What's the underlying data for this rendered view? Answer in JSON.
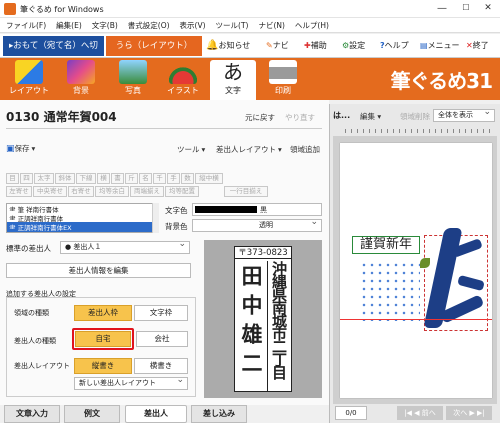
{
  "window": {
    "title": "筆ぐるめ for Windows",
    "min": "—",
    "max": "☐",
    "close": "✕"
  },
  "menu": [
    "ファイル(F)",
    "編集(E)",
    "文字(B)",
    "書式設定(O)",
    "表示(V)",
    "ツール(T)",
    "ナビ(N)",
    "ヘルプ(H)"
  ],
  "modes": {
    "front": "▸おもて（宛て名）へ切替",
    "back": "うら（レイアウト）"
  },
  "top_tools": [
    {
      "label": "お知らせ",
      "icon": "bell-icon"
    },
    {
      "label": "ナビ",
      "icon": "pen-icon"
    },
    {
      "label": "補助",
      "icon": "puzzle-icon"
    },
    {
      "label": "設定",
      "icon": "gear-icon"
    },
    {
      "label": "ヘルプ",
      "icon": "question-icon"
    },
    {
      "label": "メニュー",
      "icon": "menu-icon"
    },
    {
      "label": "終了",
      "icon": "close-icon"
    }
  ],
  "ribbon": {
    "items": [
      "レイアウト",
      "背景",
      "写真",
      "イラスト",
      "文字",
      "印刷"
    ],
    "selected": "文字",
    "brand": "筆ぐるめ31",
    "accent": "#e46b1e"
  },
  "doc": {
    "title": "0130 通常年賀004",
    "undo": "元に戻す",
    "redo": "やり直す"
  },
  "toolbar": {
    "save": "保存",
    "save_arrow": "▾",
    "tools": "ツール",
    "tools_arrow": "▾",
    "sender_layout": "差出人レイアウト",
    "sender_layout_arrow": "▾",
    "add_area": "領域追加"
  },
  "format_row1": [
    "目",
    "四",
    "太字",
    "斜体",
    "下線",
    "横",
    "書",
    "斤",
    "名",
    "千",
    "手",
    "数",
    "縦中横"
  ],
  "format_row2": [
    "左寄せ",
    "中央寄せ",
    "右寄せ",
    "均等余白",
    "両端揃え",
    "均等配置",
    "一行目揃え",
    "一行目揃要"
  ],
  "fonts": [
    "筆 祥南行書体",
    "正調祥南行書体",
    "正調祥南行書体EX"
  ],
  "text_color": {
    "label": "文字色",
    "value": "黒",
    "swatch": "#000000"
  },
  "bg_color": {
    "label": "背景色",
    "value": "透明"
  },
  "sender": {
    "label": "標準の差出人",
    "value": "● 差出人１",
    "edit": "差出人情報を編集"
  },
  "settings": {
    "title": "追加する差出人の設定",
    "area_type": "領域の種類",
    "area_opts": [
      "差出人枠",
      "文字枠"
    ],
    "sender_type": "差出人の種類",
    "sender_opts": [
      "自宅",
      "会社"
    ],
    "layout_label": "差出人レイアウト",
    "layout_opts": [
      "縦書き",
      "横書き"
    ],
    "layout_dd": "新しい差出人レイアウト"
  },
  "preview": {
    "postal": "〒373-0823",
    "addr": "沖縄県南城市二丁目",
    "name": "田中雄二"
  },
  "right": {
    "tab": "は...",
    "edit": "編集",
    "delete": "領域削除",
    "zoom": "全体を表示",
    "page": "0/0",
    "prev": "|◀ ◀ 前へ",
    "next": "次へ ▶ ▶|",
    "card_text": "謹賀新年"
  },
  "bottom_tabs": [
    "文章入力",
    "例文",
    "差出人",
    "差し込み"
  ]
}
